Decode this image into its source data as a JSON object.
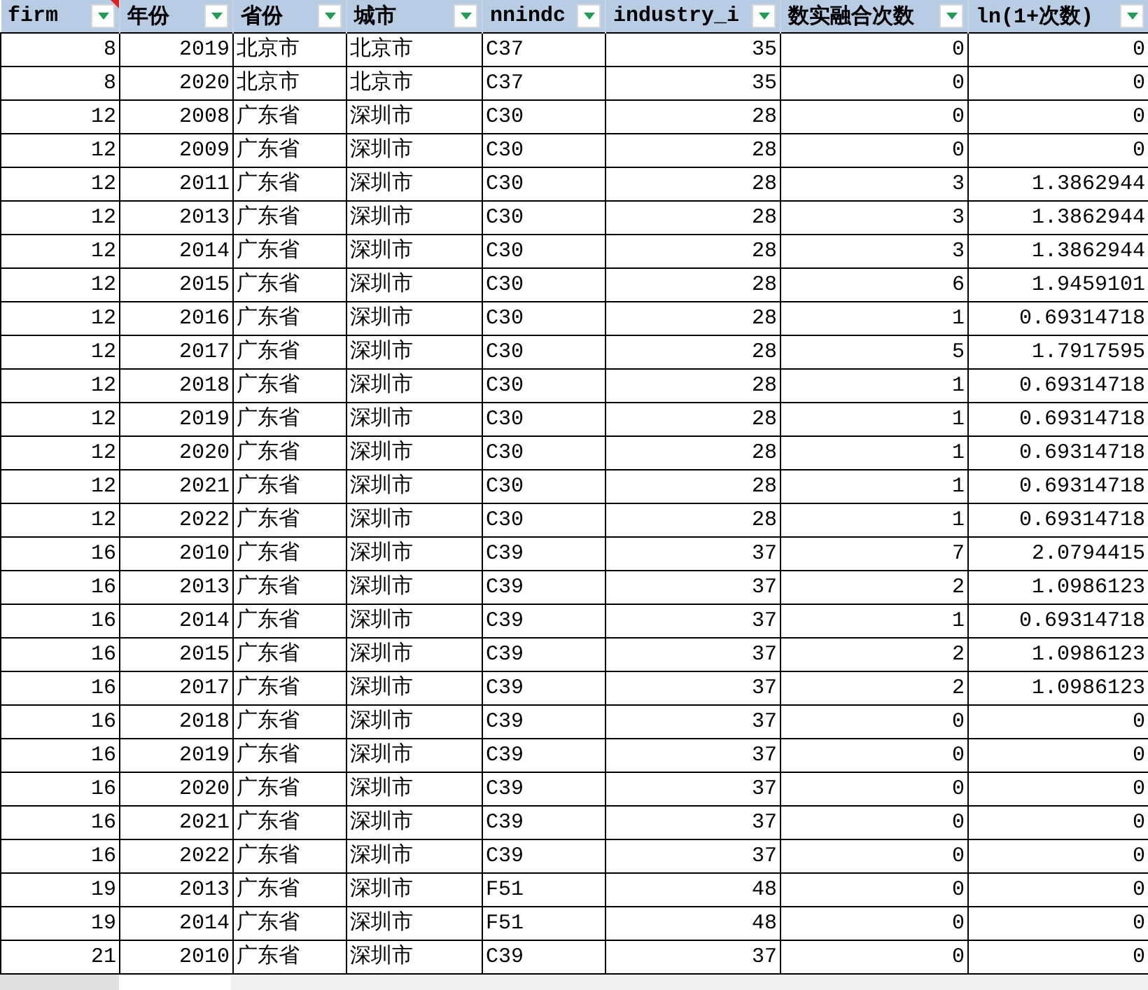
{
  "columns": [
    {
      "label": "firm",
      "kind": "number",
      "comment": true
    },
    {
      "label": "年份",
      "kind": "number"
    },
    {
      "label": "省份",
      "kind": "text"
    },
    {
      "label": "城市",
      "kind": "text"
    },
    {
      "label": "nnindc",
      "kind": "text"
    },
    {
      "label": "industry_i",
      "kind": "number"
    },
    {
      "label": "数实融合次数",
      "kind": "number"
    },
    {
      "label": "ln(1+次数)",
      "kind": "number"
    }
  ],
  "rows": [
    [
      "8",
      "2019",
      "北京市",
      "北京市",
      "C37",
      "35",
      "0",
      "0"
    ],
    [
      "8",
      "2020",
      "北京市",
      "北京市",
      "C37",
      "35",
      "0",
      "0"
    ],
    [
      "12",
      "2008",
      "广东省",
      "深圳市",
      "C30",
      "28",
      "0",
      "0"
    ],
    [
      "12",
      "2009",
      "广东省",
      "深圳市",
      "C30",
      "28",
      "0",
      "0"
    ],
    [
      "12",
      "2011",
      "广东省",
      "深圳市",
      "C30",
      "28",
      "3",
      "1.3862944"
    ],
    [
      "12",
      "2013",
      "广东省",
      "深圳市",
      "C30",
      "28",
      "3",
      "1.3862944"
    ],
    [
      "12",
      "2014",
      "广东省",
      "深圳市",
      "C30",
      "28",
      "3",
      "1.3862944"
    ],
    [
      "12",
      "2015",
      "广东省",
      "深圳市",
      "C30",
      "28",
      "6",
      "1.9459101"
    ],
    [
      "12",
      "2016",
      "广东省",
      "深圳市",
      "C30",
      "28",
      "1",
      "0.69314718"
    ],
    [
      "12",
      "2017",
      "广东省",
      "深圳市",
      "C30",
      "28",
      "5",
      "1.7917595"
    ],
    [
      "12",
      "2018",
      "广东省",
      "深圳市",
      "C30",
      "28",
      "1",
      "0.69314718"
    ],
    [
      "12",
      "2019",
      "广东省",
      "深圳市",
      "C30",
      "28",
      "1",
      "0.69314718"
    ],
    [
      "12",
      "2020",
      "广东省",
      "深圳市",
      "C30",
      "28",
      "1",
      "0.69314718"
    ],
    [
      "12",
      "2021",
      "广东省",
      "深圳市",
      "C30",
      "28",
      "1",
      "0.69314718"
    ],
    [
      "12",
      "2022",
      "广东省",
      "深圳市",
      "C30",
      "28",
      "1",
      "0.69314718"
    ],
    [
      "16",
      "2010",
      "广东省",
      "深圳市",
      "C39",
      "37",
      "7",
      "2.0794415"
    ],
    [
      "16",
      "2013",
      "广东省",
      "深圳市",
      "C39",
      "37",
      "2",
      "1.0986123"
    ],
    [
      "16",
      "2014",
      "广东省",
      "深圳市",
      "C39",
      "37",
      "1",
      "0.69314718"
    ],
    [
      "16",
      "2015",
      "广东省",
      "深圳市",
      "C39",
      "37",
      "2",
      "1.0986123"
    ],
    [
      "16",
      "2017",
      "广东省",
      "深圳市",
      "C39",
      "37",
      "2",
      "1.0986123"
    ],
    [
      "16",
      "2018",
      "广东省",
      "深圳市",
      "C39",
      "37",
      "0",
      "0"
    ],
    [
      "16",
      "2019",
      "广东省",
      "深圳市",
      "C39",
      "37",
      "0",
      "0"
    ],
    [
      "16",
      "2020",
      "广东省",
      "深圳市",
      "C39",
      "37",
      "0",
      "0"
    ],
    [
      "16",
      "2021",
      "广东省",
      "深圳市",
      "C39",
      "37",
      "0",
      "0"
    ],
    [
      "16",
      "2022",
      "广东省",
      "深圳市",
      "C39",
      "37",
      "0",
      "0"
    ],
    [
      "19",
      "2013",
      "广东省",
      "深圳市",
      "F51",
      "48",
      "0",
      "0"
    ],
    [
      "19",
      "2014",
      "广东省",
      "深圳市",
      "F51",
      "48",
      "0",
      "0"
    ],
    [
      "21",
      "2010",
      "广东省",
      "深圳市",
      "C39",
      "37",
      "0",
      "0"
    ]
  ]
}
